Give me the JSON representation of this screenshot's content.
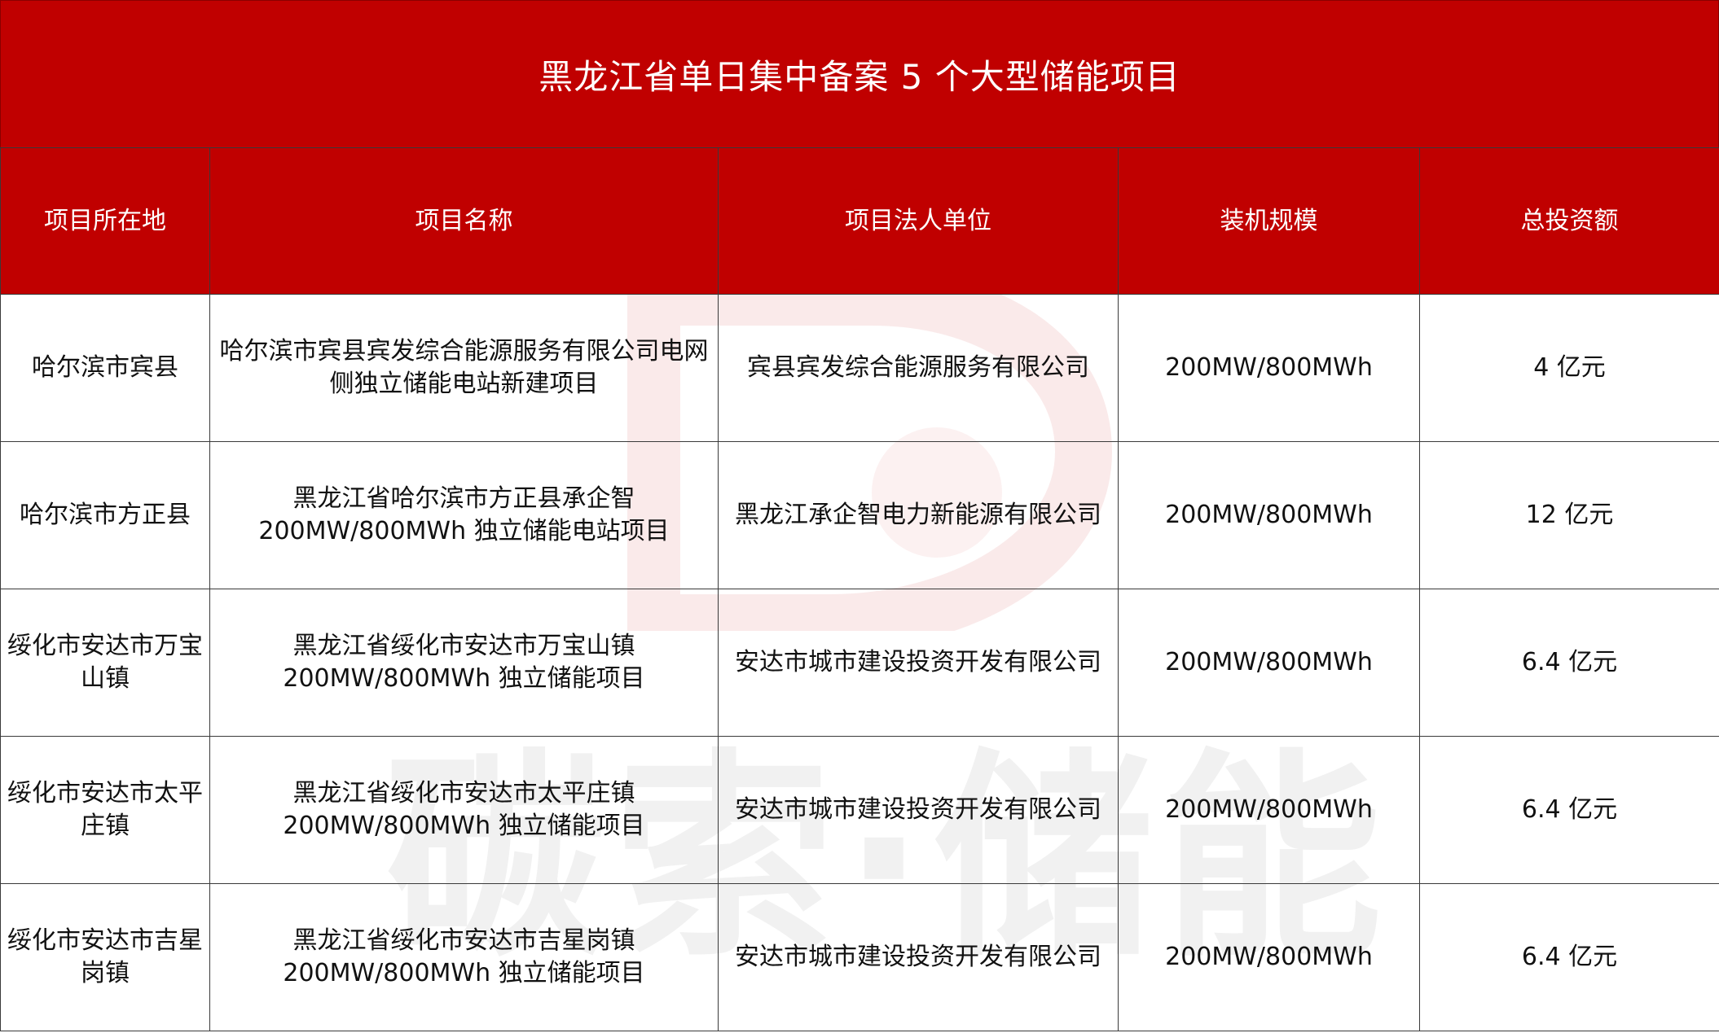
{
  "title": "黑龙江省单日集中备案 5 个大型储能项目",
  "watermark": {
    "text": "碳索·储能",
    "icon": "brand-logo-icon",
    "color": "#e06060"
  },
  "colors": {
    "header_bg": "#c00000",
    "header_text": "#ffffff",
    "body_text": "#111111"
  },
  "table": {
    "headers": [
      "项目所在地",
      "项目名称",
      "项目法人单位",
      "装机规模",
      "总投资额"
    ],
    "rows": [
      [
        "哈尔滨市宾县",
        "哈尔滨市宾县宾发综合能源服务有限公司电网侧独立储能电站新建项目",
        "宾县宾发综合能源服务有限公司",
        "200MW/800MWh",
        "4 亿元"
      ],
      [
        "哈尔滨市方正县",
        "黑龙江省哈尔滨市方正县承企智 200MW/800MWh 独立储能电站项目",
        "黑龙江承企智电力新能源有限公司",
        "200MW/800MWh",
        "12 亿元"
      ],
      [
        "绥化市安达市万宝山镇",
        "黑龙江省绥化市安达市万宝山镇 200MW/800MWh 独立储能项目",
        "安达市城市建设投资开发有限公司",
        "200MW/800MWh",
        "6.4 亿元"
      ],
      [
        "绥化市安达市太平庄镇",
        "黑龙江省绥化市安达市太平庄镇 200MW/800MWh 独立储能项目",
        "安达市城市建设投资开发有限公司",
        "200MW/800MWh",
        "6.4 亿元"
      ],
      [
        "绥化市安达市吉星岗镇",
        "黑龙江省绥化市安达市吉星岗镇 200MW/800MWh 独立储能项目",
        "安达市城市建设投资开发有限公司",
        "200MW/800MWh",
        "6.4 亿元"
      ]
    ]
  }
}
